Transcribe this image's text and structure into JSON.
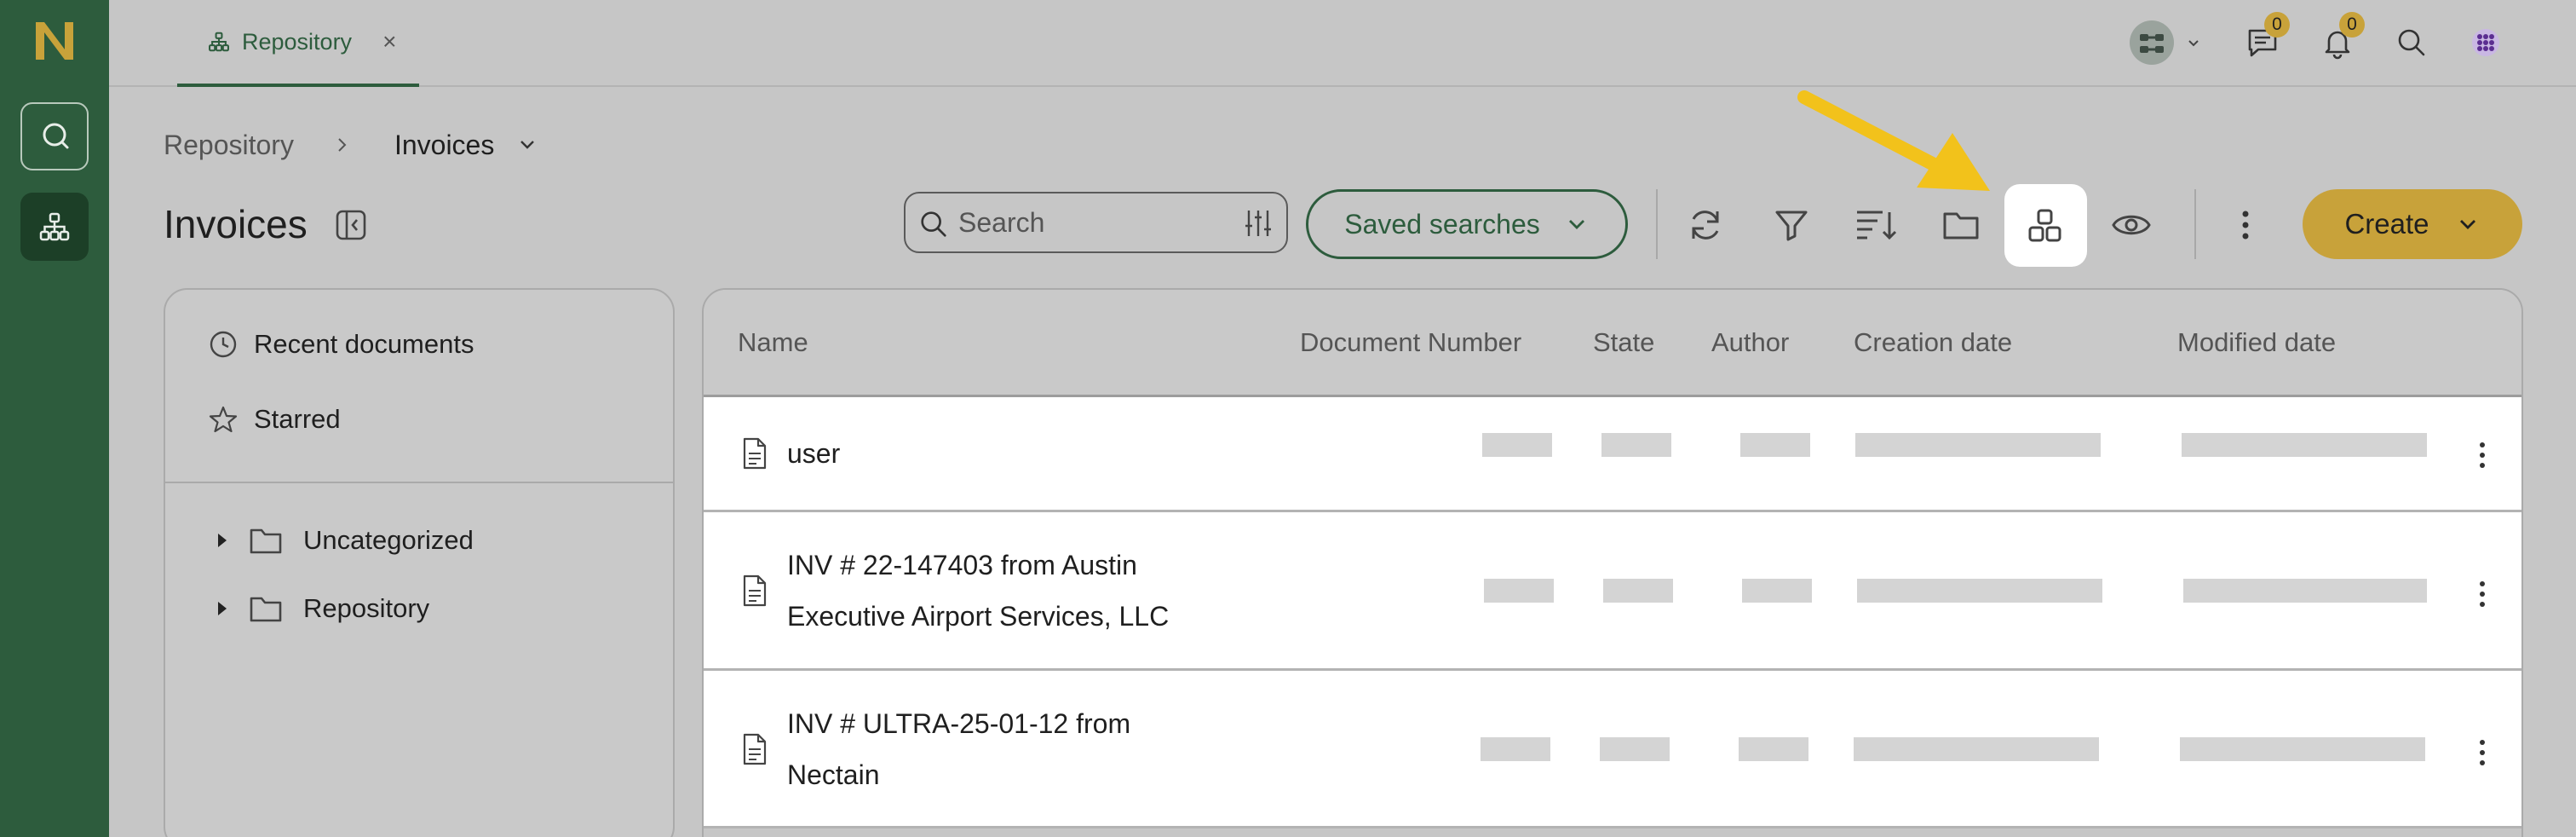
{
  "colors": {
    "rail": "#2d5c3d",
    "accent": "#c8a23a",
    "background": "#c6c6c6"
  },
  "nav_rail": {
    "logo": "N",
    "items": [
      {
        "icon": "search-icon"
      },
      {
        "icon": "hierarchy-icon"
      }
    ]
  },
  "tab": {
    "icon": "hierarchy-icon",
    "label": "Repository",
    "close": "×"
  },
  "topbar": {
    "user_menu_icon": "avatar-icon",
    "messages_badge": "0",
    "notifications_badge": "0",
    "search_icon": "search-icon",
    "apps_icon": "grid-dots-icon"
  },
  "breadcrumb": {
    "root": "Repository",
    "current": "Invoices"
  },
  "page": {
    "title": "Invoices"
  },
  "search": {
    "placeholder": "Search"
  },
  "saved_searches": {
    "label": "Saved searches"
  },
  "toolbar": {
    "tools": [
      "refresh-icon",
      "filter-icon",
      "sort-icon",
      "folder-icon",
      "layout-icon",
      "eye-icon",
      "more-vertical-icon"
    ],
    "create_label": "Create"
  },
  "left_panel": {
    "quick_links": [
      {
        "icon": "clock-icon",
        "label": "Recent documents"
      },
      {
        "icon": "star-icon",
        "label": "Starred"
      }
    ],
    "tree": [
      {
        "label": "Uncategorized"
      },
      {
        "label": "Repository"
      }
    ]
  },
  "table": {
    "columns": [
      "Name",
      "Document Number",
      "State",
      "Author",
      "Creation date",
      "Modified date"
    ],
    "rows": [
      {
        "name_line1": "user",
        "name_line2": ""
      },
      {
        "name_line1": "INV # 22-147403 from Austin",
        "name_line2": "Executive Airport Services, LLC"
      },
      {
        "name_line1": "INV # ULTRA-25-01-12 from",
        "name_line2": "Nectain"
      }
    ]
  }
}
